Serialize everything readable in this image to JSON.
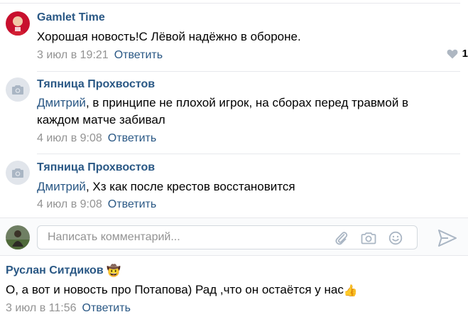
{
  "comments": [
    {
      "author": "Gamlet Time",
      "text": "Хорошая новость!С Лёвой надёжно в обороне.",
      "date": "3 июл в 19:21",
      "reply_label": "Ответить",
      "likes": "1"
    },
    {
      "author": "Тяпница Прохвостов",
      "mention": "Дмитрий",
      "text_line1": ", в принципе не плохой игрок, на сборах перед травмой в",
      "text_line2": "каждом матче забивал",
      "date": "4 июл в 9:08",
      "reply_label": "Ответить"
    },
    {
      "author": "Тяпница Прохвостов",
      "mention": "Дмитрий",
      "text": ", Хз как после крестов восстановится",
      "date": "4 июл в 9:08",
      "reply_label": "Ответить"
    }
  ],
  "composer": {
    "placeholder": "Написать комментарий..."
  },
  "post": {
    "author": "Руслан Ситдиков",
    "author_badge": "🤠",
    "text": "О, а вот и новость про Потапова) Рад ,что он остаётся у нас",
    "text_emoji": "👍",
    "date": "3 июл в 11:56",
    "reply_label": "Ответить"
  },
  "colors": {
    "link": "#2a5885",
    "meta": "#939393",
    "divider": "#e7e8ec"
  }
}
